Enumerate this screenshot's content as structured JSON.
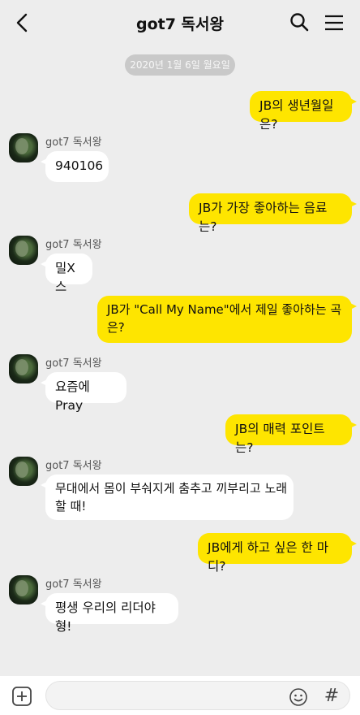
{
  "header": {
    "title": "got7 독서왕",
    "back_icon": "chevron-left-icon",
    "search_icon": "search-icon",
    "menu_icon": "hamburger-menu-icon"
  },
  "date_divider": "2020년 1월 6일 월요일",
  "sender_name": "got7 독서왕",
  "messages": [
    {
      "from": "me",
      "text": "JB의 생년월일은?"
    },
    {
      "from": "other",
      "text": "940106"
    },
    {
      "from": "me",
      "text": "JB가 가장 좋아하는 음료는?"
    },
    {
      "from": "other",
      "text": "밀X스"
    },
    {
      "from": "me",
      "line1": "JB가 \"Call My Name\"에서 제일 좋아하는 곡",
      "line2": "은?"
    },
    {
      "from": "other",
      "text": "요즘에 Pray"
    },
    {
      "from": "me",
      "text": "JB의 매력 포인트는?"
    },
    {
      "from": "other",
      "line1": "무대에서 몸이 부숴지게 춤추고 끼부리고 노래",
      "line2": "할 때!"
    },
    {
      "from": "me",
      "text": "JB에게 하고 싶은 한 마디?"
    },
    {
      "from": "other",
      "text": "평생 우리의 리더야 형!"
    }
  ],
  "input_bar": {
    "plus_icon": "plus-icon",
    "emoji_icon": "emoji-icon",
    "hash_label": "#"
  },
  "colors": {
    "background": "#ededed",
    "my_bubble": "#fee500",
    "other_bubble": "#ffffff"
  }
}
